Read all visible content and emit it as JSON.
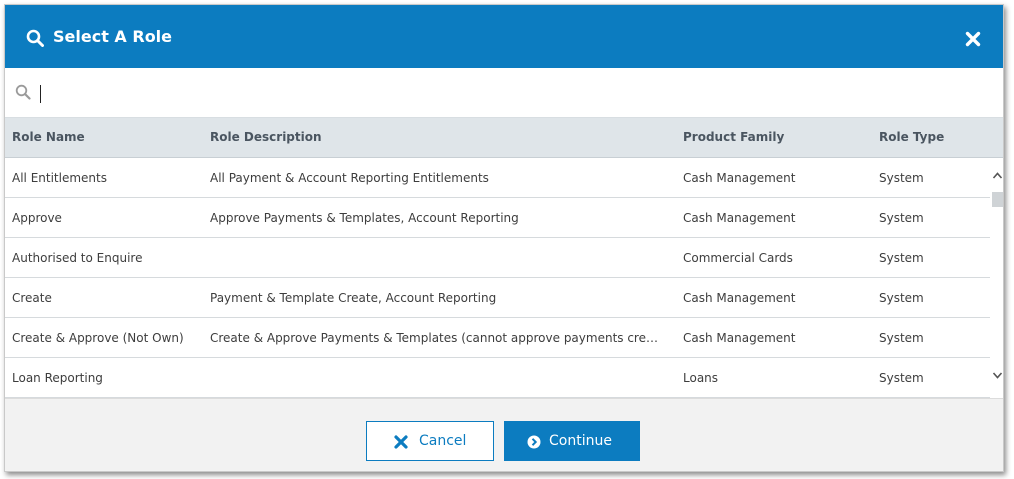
{
  "dialog": {
    "title": "Select A Role",
    "title_icon": "search-icon",
    "close_icon": "close-icon"
  },
  "search": {
    "value": "",
    "placeholder": "",
    "icon": "search-icon"
  },
  "table": {
    "columns": [
      "Role Name",
      "Role Description",
      "Product Family",
      "Role Type"
    ],
    "rows": [
      {
        "name": "All Entitlements",
        "description": "All Payment & Account Reporting Entitlements",
        "family": "Cash Management",
        "type": "System"
      },
      {
        "name": "Approve",
        "description": "Approve Payments & Templates, Account Reporting",
        "family": "Cash Management",
        "type": "System"
      },
      {
        "name": "Authorised to Enquire",
        "description": "",
        "family": "Commercial Cards",
        "type": "System"
      },
      {
        "name": "Create",
        "description": "Payment & Template Create, Account Reporting",
        "family": "Cash Management",
        "type": "System"
      },
      {
        "name": "Create & Approve (Not Own)",
        "description": "Create & Approve Payments & Templates (cannot approve payments created by self)",
        "family": "Cash Management",
        "type": "System"
      },
      {
        "name": "Loan Reporting",
        "description": "",
        "family": "Loans",
        "type": "System"
      }
    ]
  },
  "footer": {
    "cancel_label": "Cancel",
    "cancel_icon": "close-icon",
    "continue_label": "Continue",
    "continue_icon": "chevron-right-circle-icon"
  },
  "colors": {
    "primary": "#0c7cc0",
    "header_bg": "#dfe5e9",
    "footer_bg": "#f2f2f2"
  }
}
